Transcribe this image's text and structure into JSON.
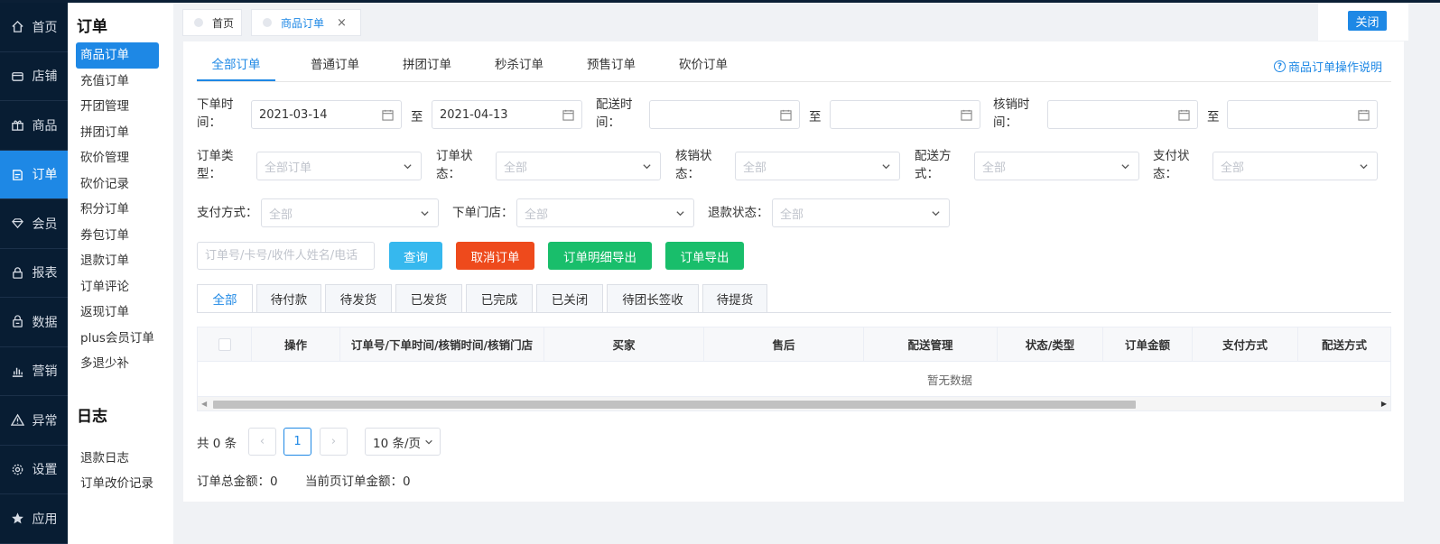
{
  "nav": {
    "items": [
      {
        "label": "首页",
        "icon": "home-icon"
      },
      {
        "label": "店铺",
        "icon": "store-icon"
      },
      {
        "label": "商品",
        "icon": "gift-icon"
      },
      {
        "label": "订单",
        "icon": "order-icon",
        "active": true
      },
      {
        "label": "会员",
        "icon": "diamond-icon"
      },
      {
        "label": "报表",
        "icon": "lock-icon"
      },
      {
        "label": "数据",
        "icon": "database-icon"
      },
      {
        "label": "营销",
        "icon": "bar-chart-icon"
      },
      {
        "label": "异常",
        "icon": "warning-icon"
      },
      {
        "label": "设置",
        "icon": "gear-icon"
      },
      {
        "label": "应用",
        "icon": "star-icon"
      }
    ]
  },
  "submenu": {
    "title": "订单",
    "items": [
      "商品订单",
      "充值订单",
      "开团管理",
      "拼团订单",
      "砍价管理",
      "砍价记录",
      "积分订单",
      "券包订单",
      "退款订单",
      "订单评论",
      "返现订单",
      "plus会员订单",
      "多退少补"
    ],
    "title2": "日志",
    "items2": [
      "退款日志",
      "订单改价记录"
    ]
  },
  "page_tabs": {
    "home": "首页",
    "current": "商品订单",
    "close_glyph": "×",
    "close_button": "关闭"
  },
  "order_tabs": [
    "全部订单",
    "普通订单",
    "拼团订单",
    "秒杀订单",
    "预售订单",
    "砍价订单"
  ],
  "help_link": "商品订单操作说明",
  "filters": {
    "order_time_label_1": "下单时",
    "order_time_label_2": "间：",
    "order_time_start": "2021-03-14",
    "to": "至",
    "order_time_end": "2021-04-13",
    "delivery_time_label_1": "配送时",
    "delivery_time_label_2": "间：",
    "verify_time_label_1": "核销时",
    "verify_time_label_2": "间：",
    "order_type_label_1": "订单类",
    "order_type_label_2": "型：",
    "order_type_placeholder": "全部订单",
    "order_status_label_1": "订单状",
    "order_status_label_2": "态：",
    "verify_status_label_1": "核销状",
    "verify_status_label_2": "态：",
    "delivery_method_label_1": "配送方",
    "delivery_method_label_2": "式：",
    "pay_status_label_1": "支付状",
    "pay_status_label_2": "态：",
    "all_placeholder": "全部",
    "pay_method_label": "支付方式：",
    "store_label": "下单门店：",
    "refund_status_label": "退款状态："
  },
  "search": {
    "placeholder": "订单号/卡号/收件人姓名/电话",
    "query": "查询",
    "cancel": "取消订单",
    "export_detail": "订单明细导出",
    "export": "订单导出"
  },
  "colors": {
    "primary": "#1e88e5",
    "query": "#36b8ee",
    "danger": "#ee4a1c",
    "success": "#19be6b"
  },
  "status_tabs": [
    "全部",
    "待付款",
    "待发货",
    "已发货",
    "已完成",
    "已关闭",
    "待团长签收",
    "待提货"
  ],
  "table": {
    "columns": [
      "操作",
      "订单号/下单时间/核销时间/核销门店",
      "买家",
      "售后",
      "配送管理",
      "状态/类型",
      "订单金额",
      "支付方式",
      "配送方式"
    ],
    "empty": "暂无数据"
  },
  "pagination": {
    "total": "共 0 条",
    "current_page": "1",
    "prev": "‹",
    "next": "›",
    "page_size": "10 条/页"
  },
  "summary": {
    "total_amount": "订单总金额：0",
    "page_amount": "当前页订单金额：0"
  }
}
